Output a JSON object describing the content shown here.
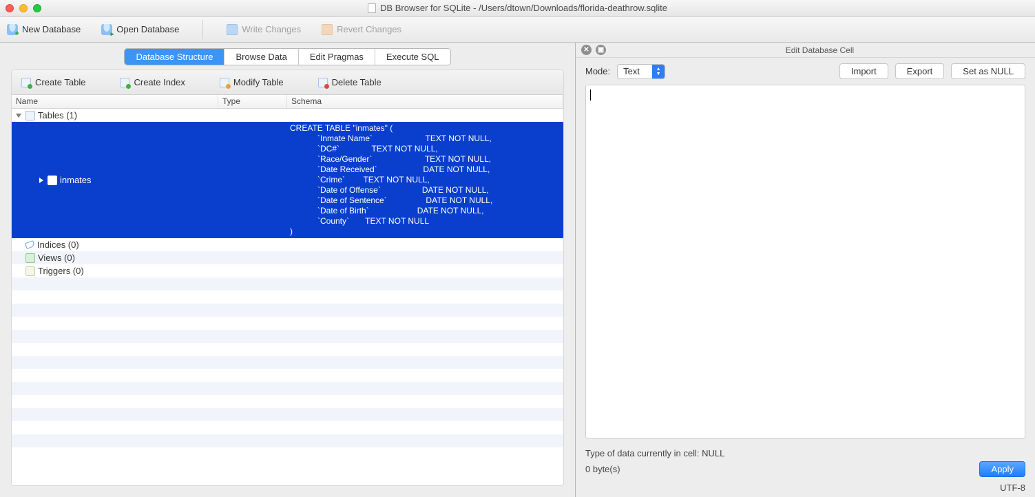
{
  "window": {
    "title": "DB Browser for SQLite - /Users/dtown/Downloads/florida-deathrow.sqlite"
  },
  "toolbar": {
    "new_database": "New Database",
    "open_database": "Open Database",
    "write_changes": "Write Changes",
    "revert_changes": "Revert Changes"
  },
  "tabs": {
    "database_structure": "Database Structure",
    "browse_data": "Browse Data",
    "edit_pragmas": "Edit Pragmas",
    "execute_sql": "Execute SQL"
  },
  "sub_toolbar": {
    "create_table": "Create Table",
    "create_index": "Create Index",
    "modify_table": "Modify Table",
    "delete_table": "Delete Table"
  },
  "tree": {
    "headers": {
      "name": "Name",
      "type": "Type",
      "schema": "Schema"
    },
    "tables_label": "Tables (1)",
    "table_name": "inmates",
    "table_schema": "CREATE TABLE \"inmates\" (\n            `Inmate Name`                       TEXT NOT NULL,\n            `DC#`              TEXT NOT NULL,\n            `Race/Gender`                       TEXT NOT NULL,\n            `Date Received`                    DATE NOT NULL,\n            `Crime`        TEXT NOT NULL,\n            `Date of Offense`                  DATE NOT NULL,\n            `Date of Sentence`                 DATE NOT NULL,\n            `Date of Birth`                     DATE NOT NULL,\n            `County`       TEXT NOT NULL\n)",
    "indices_label": "Indices (0)",
    "views_label": "Views (0)",
    "triggers_label": "Triggers (0)"
  },
  "right": {
    "panel_title": "Edit Database Cell",
    "mode_label": "Mode:",
    "mode_value": "Text",
    "import": "Import",
    "export": "Export",
    "set_null": "Set as NULL",
    "editor_value": "",
    "type_info": "Type of data currently in cell: NULL",
    "size_info": "0 byte(s)",
    "apply": "Apply",
    "encoding": "UTF-8"
  }
}
